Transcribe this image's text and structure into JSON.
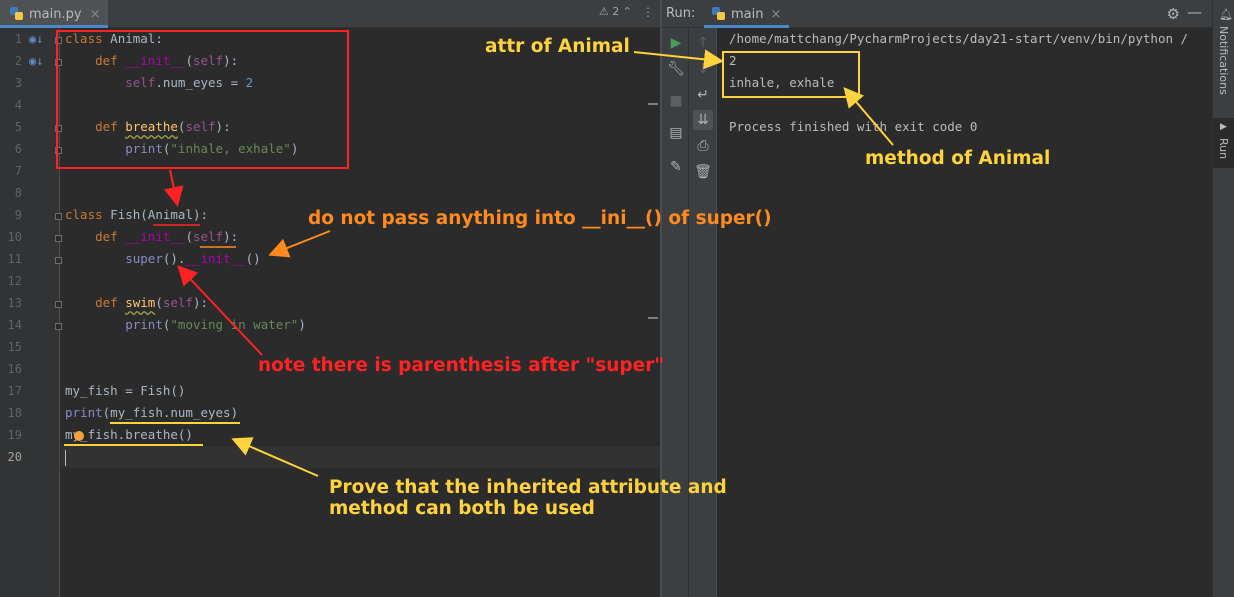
{
  "editor": {
    "tab": {
      "filename": "main.py",
      "close": "×"
    },
    "tab_menu": "⋮",
    "inspection_widget": "⚠ 2 ⌃",
    "line_numbers": [
      "1",
      "2",
      "3",
      "4",
      "5",
      "6",
      "7",
      "8",
      "9",
      "10",
      "11",
      "12",
      "13",
      "14",
      "15",
      "16",
      "17",
      "18",
      "19",
      "20"
    ],
    "current_line": 20
  },
  "run_panel": {
    "label": "Run:",
    "tab": {
      "name": "main",
      "close": "×"
    },
    "toolbar_icons": [
      "rerun-icon",
      "wrench-icon",
      "stop-icon",
      "layout-icon",
      "pin-icon",
      "up-arrow-icon",
      "down-arrow-icon",
      "soft-wrap-icon",
      "scroll-to-end-icon",
      "print-icon",
      "trash-icon"
    ],
    "output": [
      "/home/mattchang/PycharmProjects/day21-start/venv/bin/python /",
      "2",
      "inhale, exhale",
      "",
      "Process finished with exit code 0"
    ]
  },
  "side_stripe": {
    "notifications": "Notifications",
    "run": "Run"
  },
  "annotations": {
    "attr": "attr of Animal",
    "method": "method of Animal",
    "do_not_pass": "do not pass anything into __ini__() of super()",
    "parenthesis": "note there is parenthesis after \"super\"",
    "prove_line1": "Prove that the inherited attribute and",
    "prove_line2": "method can both be used"
  },
  "colors": {
    "annotation_red": "#ff2222",
    "annotation_orange": "#ff8a1f",
    "annotation_yellow": "#ffd33d",
    "editor_bg": "#2b2b2b",
    "keyword": "#cc7832"
  }
}
